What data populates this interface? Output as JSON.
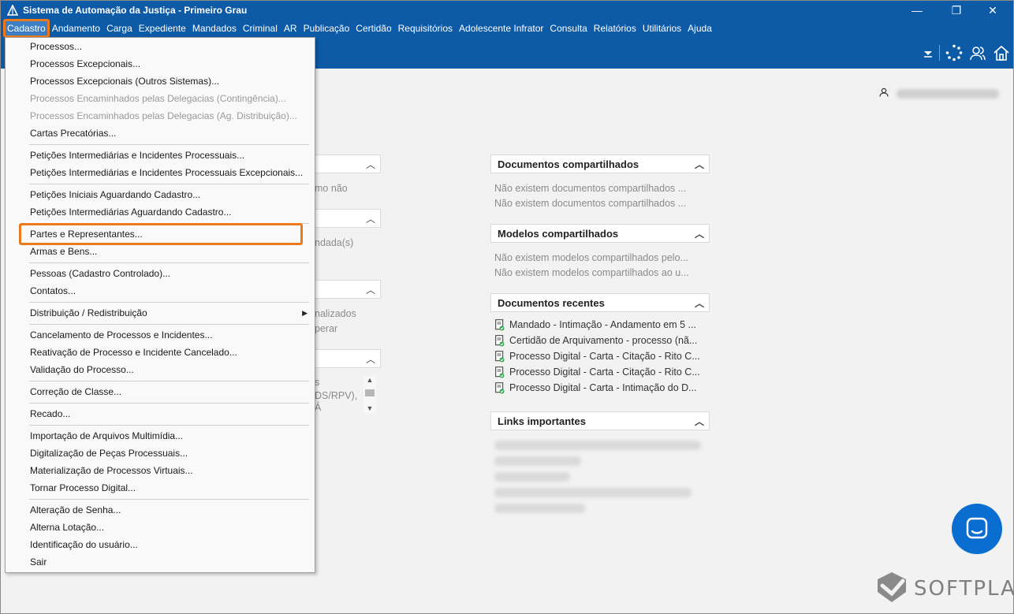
{
  "window": {
    "title": "Sistema de Automação da Justiça - Primeiro Grau",
    "controls": {
      "minimize": "—",
      "maximize": "❐",
      "close": "✕"
    }
  },
  "menubar": [
    "Cadastro",
    "Andamento",
    "Carga",
    "Expediente",
    "Mandados",
    "Criminal",
    "AR",
    "Publicação",
    "Certidão",
    "Requisitórios",
    "Adolescente Infrator",
    "Consulta",
    "Relatórios",
    "Utilitários",
    "Ajuda"
  ],
  "cadastro_menu": {
    "groups": [
      [
        {
          "label": "Processos...",
          "enabled": true
        },
        {
          "label": "Processos Excepcionais...",
          "enabled": true
        },
        {
          "label": "Processos Excepcionais (Outros Sistemas)...",
          "enabled": true
        },
        {
          "label": "Processos Encaminhados pelas Delegacias (Contingência)...",
          "enabled": false
        },
        {
          "label": "Processos Encaminhados pelas Delegacias (Ag. Distribuição)...",
          "enabled": false
        },
        {
          "label": "Cartas Precatórias...",
          "enabled": true
        }
      ],
      [
        {
          "label": "Petições Intermediárias e Incidentes Processuais...",
          "enabled": true
        },
        {
          "label": "Petições Intermediárias e Incidentes Processuais Excepcionais...",
          "enabled": true
        }
      ],
      [
        {
          "label": "Petições Iniciais Aguardando Cadastro...",
          "enabled": true
        },
        {
          "label": "Petições Intermediárias Aguardando Cadastro...",
          "enabled": true
        }
      ],
      [
        {
          "label": "Partes e Representantes...",
          "enabled": true,
          "highlighted": true
        },
        {
          "label": "Armas e Bens...",
          "enabled": true
        }
      ],
      [
        {
          "label": "Pessoas (Cadastro Controlado)...",
          "enabled": true
        },
        {
          "label": "Contatos...",
          "enabled": true
        }
      ],
      [
        {
          "label": "Distribuição / Redistribuição",
          "enabled": true,
          "submenu": true
        }
      ],
      [
        {
          "label": "Cancelamento de Processos e Incidentes...",
          "enabled": true
        },
        {
          "label": "Reativação de Processo e Incidente Cancelado...",
          "enabled": true
        },
        {
          "label": "Validação do Processo...",
          "enabled": true
        }
      ],
      [
        {
          "label": "Correção de Classe...",
          "enabled": true
        }
      ],
      [
        {
          "label": "Recado...",
          "enabled": true
        }
      ],
      [
        {
          "label": "Importação de Arquivos Multimídia...",
          "enabled": true
        },
        {
          "label": "Digitalização de Peças Processuais...",
          "enabled": true
        },
        {
          "label": "Materialização de Processos Virtuais...",
          "enabled": true
        },
        {
          "label": "Tornar Processo Digital...",
          "enabled": true
        }
      ],
      [
        {
          "label": "Alteração de Senha...",
          "enabled": true
        },
        {
          "label": "Alterna Lotação...",
          "enabled": true
        },
        {
          "label": "Identificação do usuário...",
          "enabled": true
        },
        {
          "label": "Sair",
          "enabled": true
        }
      ]
    ]
  },
  "left_partial": {
    "text1": "mo não",
    "text2": "ndada(s)",
    "text3a": "nalizados",
    "text3b": "perar",
    "text4a": "s",
    "text4b": "DS/RPV),",
    "text4c": "Á"
  },
  "panels": {
    "shared_docs": {
      "title": "Documentos compartilhados",
      "lines": [
        "Não existem documentos compartilhados ...",
        "Não existem documentos compartilhados ..."
      ]
    },
    "shared_models": {
      "title": "Modelos compartilhados",
      "lines": [
        "Não existem modelos compartilhados pelo...",
        "Não existem modelos compartilhados ao u..."
      ]
    },
    "recent_docs": {
      "title": "Documentos recentes",
      "items": [
        "Mandado - Intimação - Andamento em 5 ...",
        "Certidão de Arquivamento - processo (nã...",
        "Processo Digital - Carta - Citação - Rito C...",
        "Processo Digital - Carta - Citação - Rito C...",
        "Processo Digital - Carta - Intimação do D..."
      ]
    },
    "links": {
      "title": "Links importantes"
    }
  },
  "brand": {
    "name": "SOFTPLAN"
  },
  "colors": {
    "titlebar": "#0d5aa7",
    "highlight": "#ec7a1c",
    "chat": "#0a6ed1"
  }
}
